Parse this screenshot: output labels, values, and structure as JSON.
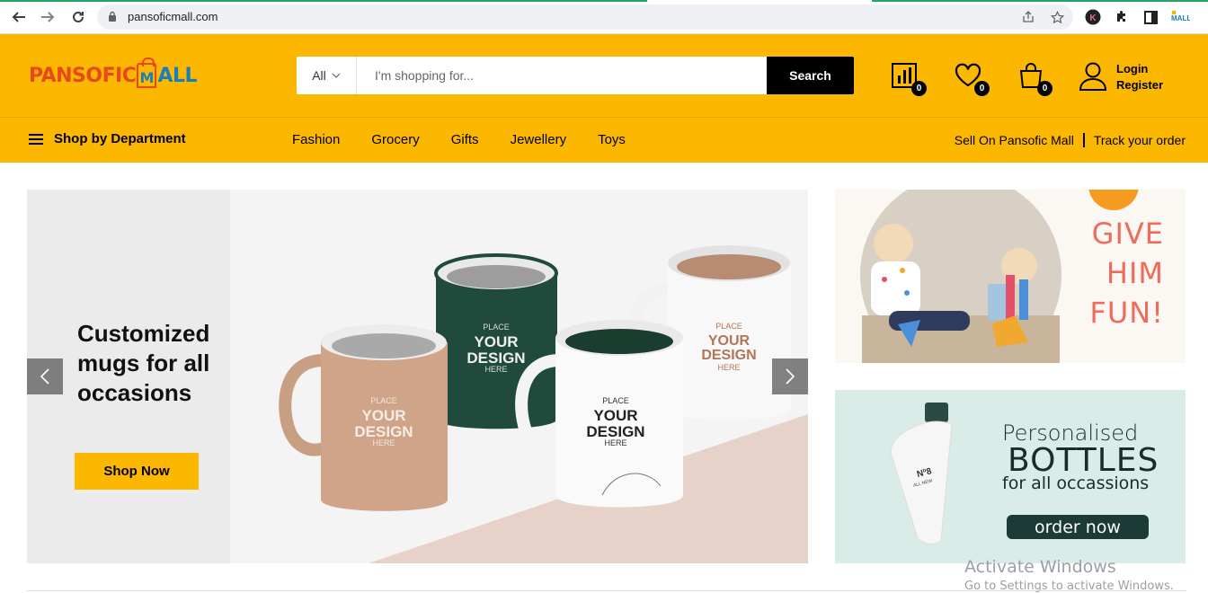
{
  "browser": {
    "url": "pansoficmall.com",
    "icons": [
      "back-icon",
      "forward-icon",
      "reload-icon",
      "lock-icon",
      "share-icon",
      "bookmark-star-icon",
      "profile-icon",
      "extensions-icon",
      "sidebar-icon",
      "mall-extension-icon"
    ]
  },
  "header": {
    "logo": {
      "part1": "PANSOFIC",
      "part2": "ALL",
      "bag_letter": "M"
    },
    "search": {
      "category": "All",
      "placeholder": "I'm shopping for...",
      "button": "Search"
    },
    "compare_count": "0",
    "wishlist_count": "0",
    "cart_count": "0",
    "login": "Login",
    "register": "Register"
  },
  "navbar": {
    "department": "Shop by Department",
    "menu": [
      "Fashion",
      "Grocery",
      "Gifts",
      "Jewellery",
      "Toys"
    ],
    "sell": "Sell On Pansofic Mall",
    "track": "Track your order"
  },
  "hero": {
    "headline": "Customized mugs for all occasions",
    "button": "Shop Now",
    "mug_text": [
      "PLACE",
      "YOUR",
      "DESIGN",
      "HERE"
    ]
  },
  "promo_kids": {
    "lines": [
      "GIVE",
      "HIM",
      "FUN!"
    ]
  },
  "promo_bottles": {
    "line1": "Personalised",
    "line2": "BOTTLES",
    "line3": "for all occassions",
    "button": "order now",
    "bottle_label": [
      "Nº8",
      "ALL NEW"
    ]
  },
  "windows": {
    "title": "Activate Windows",
    "subtitle": "Go to Settings to activate Windows."
  },
  "colors": {
    "brand": "#fcb800",
    "black": "#000000",
    "logo_orange": "#e8481c",
    "logo_blue": "#1a7fb8",
    "promo_coral": "#ef6b5c"
  }
}
